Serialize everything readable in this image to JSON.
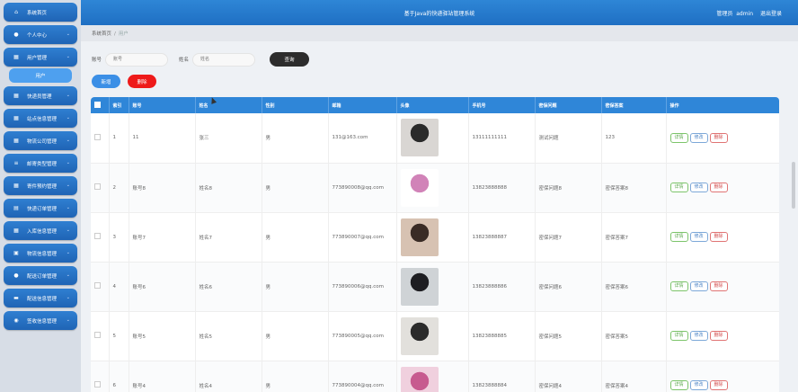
{
  "sidebar": {
    "items": [
      {
        "label": "系统首页",
        "icon": "home-icon",
        "glyph": "⌂"
      },
      {
        "label": "个人中心",
        "icon": "user-icon",
        "glyph": "●"
      },
      {
        "label": "用户管理",
        "icon": "grid-icon",
        "glyph": "▦",
        "sub": "用户"
      },
      {
        "label": "快递员管理",
        "icon": "grid-icon",
        "glyph": "▦"
      },
      {
        "label": "站点信息管理",
        "icon": "grid-icon",
        "glyph": "▦"
      },
      {
        "label": "物流公司管理",
        "icon": "grid-icon",
        "glyph": "▦"
      },
      {
        "label": "邮寄类型管理",
        "icon": "list-icon",
        "glyph": "≡"
      },
      {
        "label": "寄件预约管理",
        "icon": "grid-icon",
        "glyph": "▦"
      },
      {
        "label": "快递订单管理",
        "icon": "doc-icon",
        "glyph": "▤"
      },
      {
        "label": "入库信息管理",
        "icon": "grid-icon",
        "glyph": "▦"
      },
      {
        "label": "物流信息管理",
        "icon": "box-icon",
        "glyph": "▣"
      },
      {
        "label": "配送订单管理",
        "icon": "user-icon",
        "glyph": "●"
      },
      {
        "label": "配送信息管理",
        "icon": "card-icon",
        "glyph": "▬"
      },
      {
        "label": "签收信息管理",
        "icon": "db-icon",
        "glyph": "◉"
      }
    ]
  },
  "topbar": {
    "title": "基于Java的快递驿站管理系统",
    "role": "管理员",
    "username": "admin",
    "logout": "退出登录"
  },
  "breadcrumb": {
    "home": "系统首页",
    "separator": "/",
    "current": "用户"
  },
  "search": {
    "account_label": "账号",
    "account_placeholder": "账号",
    "name_label": "姓名",
    "name_placeholder": "姓名",
    "query_button": "查询"
  },
  "actions": {
    "add": "新增",
    "delete": "删除"
  },
  "table": {
    "columns": [
      "索引",
      "账号",
      "姓名",
      "性别",
      "邮箱",
      "头像",
      "手机号",
      "密保问题",
      "密保答案",
      "操作"
    ],
    "row_buttons": {
      "detail": "详情",
      "edit": "修改",
      "delete": "删除"
    },
    "rows": [
      {
        "index": "1",
        "account": "11",
        "name": "张三",
        "gender": "男",
        "email": "131@163.com",
        "phone": "13111111111",
        "question": "测试问题",
        "answer": "123",
        "avatar_color": "#d9d6d3",
        "avatar_dark": "#2a2a2a"
      },
      {
        "index": "2",
        "account": "账号8",
        "name": "姓名8",
        "gender": "男",
        "email": "773890008@qq.com",
        "phone": "13823888888",
        "question": "密保问题8",
        "answer": "密保答案8",
        "avatar_color": "#ffffff",
        "avatar_dark": "#d183b8"
      },
      {
        "index": "3",
        "account": "账号7",
        "name": "姓名7",
        "gender": "男",
        "email": "773890007@qq.com",
        "phone": "13823888887",
        "question": "密保问题7",
        "answer": "密保答案7",
        "avatar_color": "#d7c2b2",
        "avatar_dark": "#3a2c26"
      },
      {
        "index": "4",
        "account": "账号6",
        "name": "姓名6",
        "gender": "男",
        "email": "773890006@qq.com",
        "phone": "13823888886",
        "question": "密保问题6",
        "answer": "密保答案6",
        "avatar_color": "#cfd3d6",
        "avatar_dark": "#1e1e22"
      },
      {
        "index": "5",
        "account": "账号5",
        "name": "姓名5",
        "gender": "男",
        "email": "773890005@qq.com",
        "phone": "13823888885",
        "question": "密保问题5",
        "answer": "密保答案5",
        "avatar_color": "#e2e0dc",
        "avatar_dark": "#2b2b2b"
      },
      {
        "index": "6",
        "account": "账号4",
        "name": "姓名4",
        "gender": "男",
        "email": "773890004@qq.com",
        "phone": "13823888884",
        "question": "密保问题4",
        "answer": "密保答案4",
        "avatar_color": "#f0d0de",
        "avatar_dark": "#c75a8f"
      }
    ]
  },
  "colors": {
    "primary": "#1f6fc3",
    "accent": "#3b8fe6",
    "danger": "#ee1a1a"
  }
}
